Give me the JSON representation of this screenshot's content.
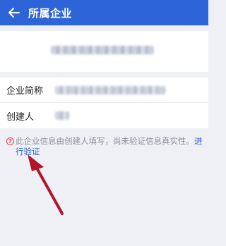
{
  "header": {
    "title": "所属企业",
    "back_icon": "back-arrow-icon"
  },
  "company": {
    "name_blurred": ""
  },
  "info": {
    "short_name_label": "企业简称",
    "creator_label": "创建人"
  },
  "notice": {
    "icon": "question-circle-icon",
    "text": "此企业信息由创建人填写，尚未验证信息真实性。",
    "link": "进行验证"
  },
  "colors": {
    "accent": "#2d64d8",
    "annotation_arrow": "#b0152b"
  }
}
